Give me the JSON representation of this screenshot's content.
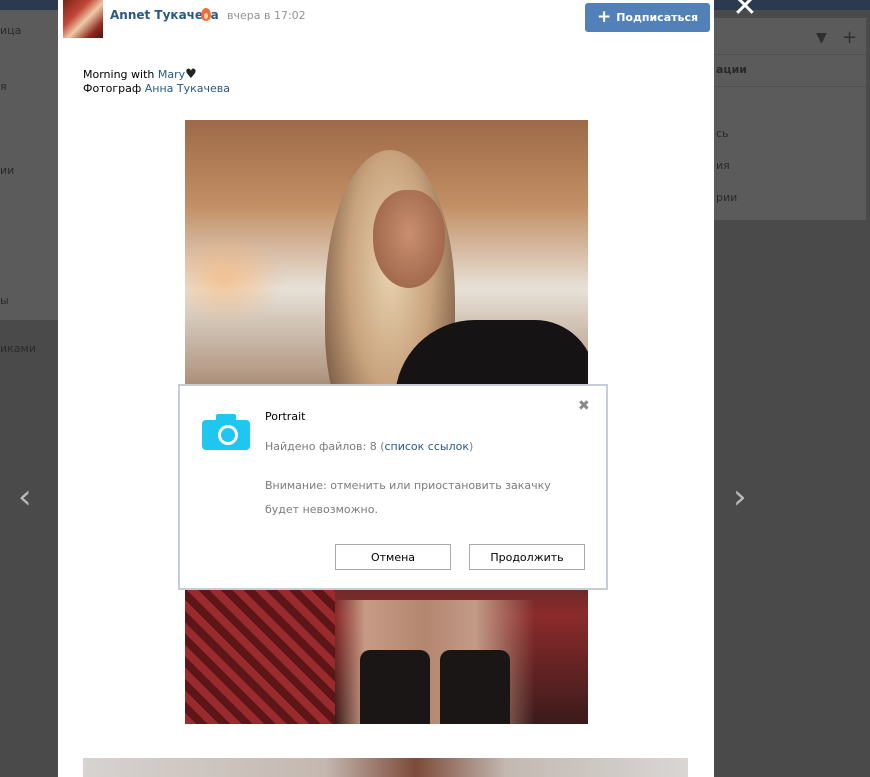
{
  "background": {
    "left_items": [
      "ица",
      "я",
      "ии",
      "ы",
      "иками"
    ],
    "right_items": [
      "ации",
      "сь",
      "ия",
      "рии"
    ]
  },
  "post": {
    "author": "Annet Тукачева",
    "time": "вчера в 17:02",
    "subscribe_label": "Подписаться",
    "caption": {
      "line1_text": "Morning with ",
      "line1_link": "Mary",
      "line2_text": "Фотограф ",
      "line2_link": "Анна Тукачева"
    }
  },
  "dialog": {
    "title": "Portrait",
    "found_text": "Найдено файлов: 8 (",
    "found_link": "список ссылок",
    "found_suffix": ")",
    "warning": "Внимание: отменить или приостановить закачку будет невозможно.",
    "cancel_label": "Отмена",
    "continue_label": "Продолжить"
  },
  "icons": {
    "camera_color": "#1ec6f0",
    "accent": "#5181b8",
    "link_color": "#2a5885"
  }
}
